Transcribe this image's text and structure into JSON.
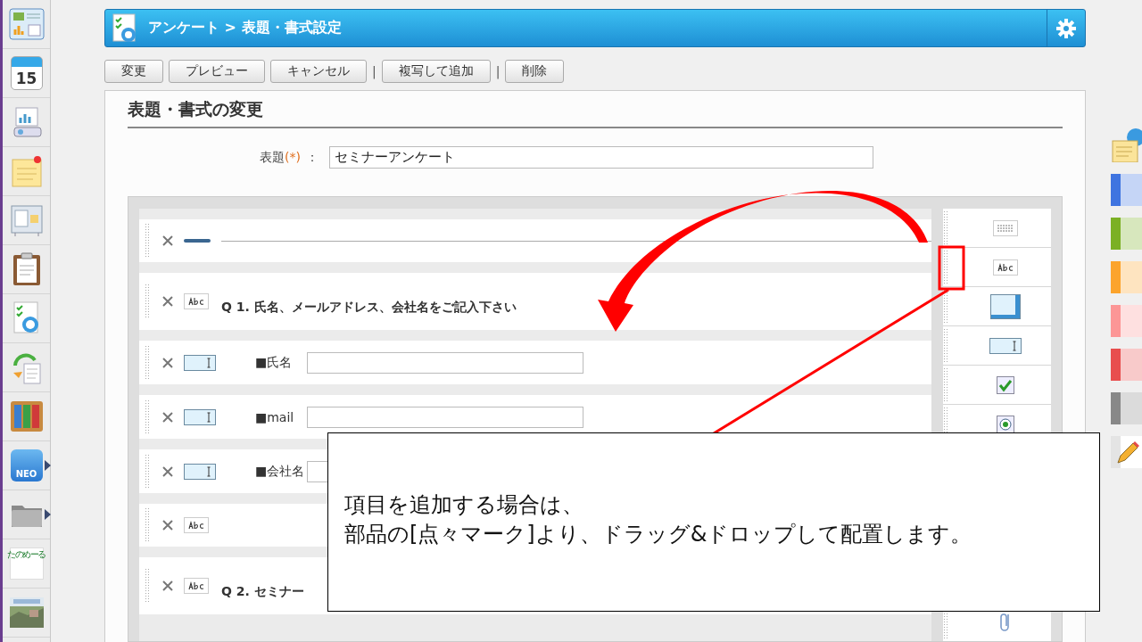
{
  "sidebar": {
    "items": [
      {
        "kind": "portal"
      },
      {
        "kind": "calendar",
        "label": "15"
      },
      {
        "kind": "presentation"
      },
      {
        "kind": "memo"
      },
      {
        "kind": "board"
      },
      {
        "kind": "clipboard"
      },
      {
        "kind": "survey"
      },
      {
        "kind": "sync"
      },
      {
        "kind": "binders"
      },
      {
        "kind": "neo",
        "label": "NEO",
        "submenu": true
      },
      {
        "kind": "folder",
        "submenu": true
      },
      {
        "kind": "logo",
        "label": "たのめーる"
      },
      {
        "kind": "picture"
      }
    ]
  },
  "header": {
    "title": "アンケート > 表題・書式設定"
  },
  "toolbar": {
    "items": [
      {
        "kind": "button",
        "label": "変更"
      },
      {
        "kind": "button",
        "label": "プレビュー"
      },
      {
        "kind": "button",
        "label": "キャンセル"
      },
      {
        "kind": "separator",
        "label": "|"
      },
      {
        "kind": "button",
        "label": "複写して追加"
      },
      {
        "kind": "separator",
        "label": "|"
      },
      {
        "kind": "button",
        "label": "削除"
      }
    ]
  },
  "form": {
    "heading": "表題・書式の変更",
    "title_field": {
      "label": "表題",
      "required": "(*)",
      "colon": "：",
      "value": "セミナーアンケート"
    }
  },
  "rows": [
    {
      "kind": "divider"
    },
    {
      "kind": "text",
      "text": "Q 1. 氏名、メールアドレス、会社名をご記入下さい"
    },
    {
      "kind": "input",
      "label": "■氏名"
    },
    {
      "kind": "input",
      "label": "■mail"
    },
    {
      "kind": "input",
      "label": "■会社名"
    },
    {
      "kind": "text"
    },
    {
      "kind": "text",
      "text": "Q 2. セミナー"
    }
  ],
  "palette": {
    "items": [
      {
        "kind": "layout"
      },
      {
        "kind": "text"
      },
      {
        "kind": "textarea"
      },
      {
        "kind": "input"
      },
      {
        "kind": "checkbox"
      },
      {
        "kind": "radio"
      },
      {
        "kind": "attachment"
      }
    ]
  },
  "right_strip": {
    "swatches": [
      {
        "color": "#3f74e0"
      },
      {
        "color": "#7bb024"
      },
      {
        "color": "#fca42c"
      },
      {
        "color": "#fc9696"
      },
      {
        "color": "#e84e4e"
      },
      {
        "color": "#888888"
      }
    ]
  },
  "callout": {
    "lines": [
      "項目を追加する場合は、",
      "部品の[点々マーク]より、ドラッグ&ドロップして配置します。"
    ]
  }
}
